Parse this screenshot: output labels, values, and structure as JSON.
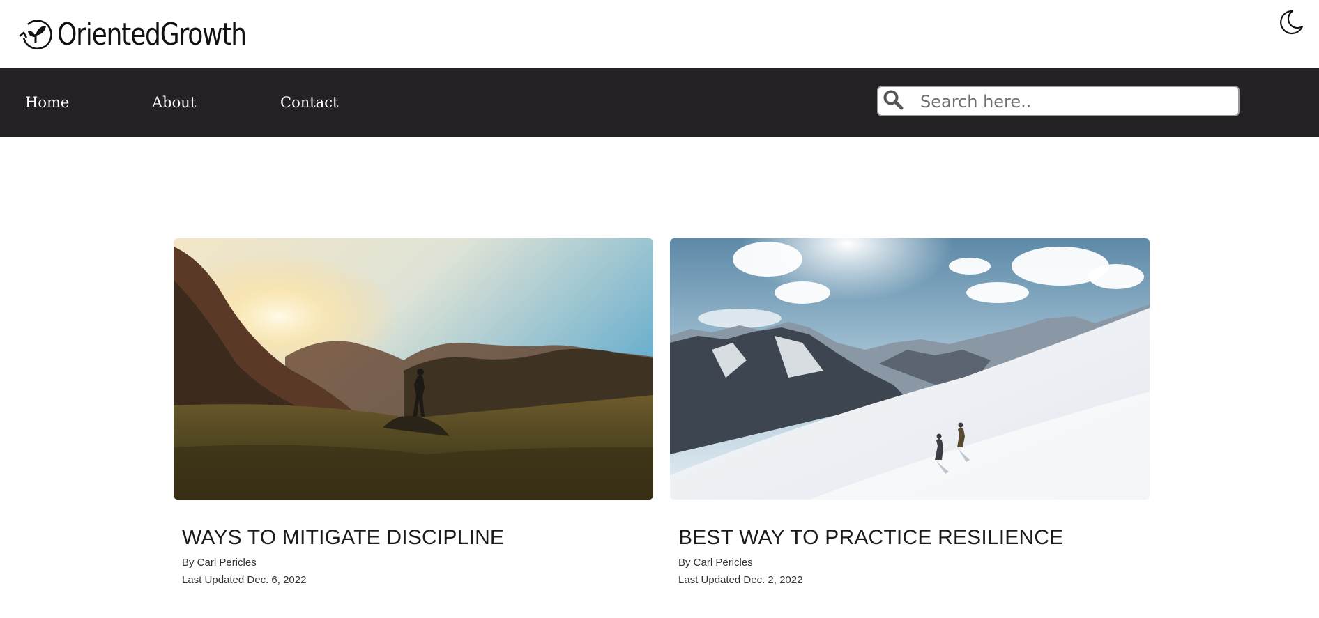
{
  "brand": {
    "name": "OrientedGrowth",
    "logo_icon": "sprout-circle-icon"
  },
  "theme_toggle": {
    "icon": "crescent-moon-icon"
  },
  "nav": {
    "items": [
      {
        "label": "Home"
      },
      {
        "label": "About"
      },
      {
        "label": "Contact"
      }
    ]
  },
  "search": {
    "placeholder": "Search here..",
    "value": "",
    "icon": "search-icon"
  },
  "posts": [
    {
      "title": "WAYS TO MITIGATE DISCIPLINE",
      "author": "By Carl Pericles",
      "updated": "Last Updated Dec. 6, 2022",
      "image": "sunset-mountain-hiker-photo"
    },
    {
      "title": "BEST WAY TO PRACTICE RESILIENCE",
      "author": "By Carl Pericles",
      "updated": "Last Updated Dec. 2, 2022",
      "image": "snowy-mountain-climbers-photo"
    }
  ],
  "colors": {
    "navbar_bg": "#232123",
    "nav_text": "#ffffff",
    "page_bg": "#ffffff"
  }
}
